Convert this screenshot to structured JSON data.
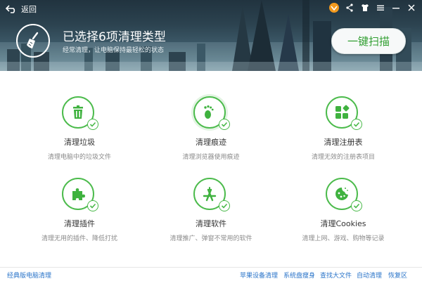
{
  "header": {
    "back_label": "返回",
    "title": "已选择6项清理类型",
    "subtitle": "经常清理，让电脑保持最轻松的状态",
    "scan_button": "一键扫描"
  },
  "items": [
    {
      "title": "清理垃圾",
      "desc": "清理电脑中的垃圾文件",
      "icon": "trash-icon",
      "checked": true
    },
    {
      "title": "清理痕迹",
      "desc": "清理浏览器使用痕迹",
      "icon": "footprint-icon",
      "checked": true
    },
    {
      "title": "清理注册表",
      "desc": "清理无效的注册表项目",
      "icon": "registry-icon",
      "checked": true
    },
    {
      "title": "清理插件",
      "desc": "清理无用的插件、降低打扰",
      "icon": "puzzle-icon",
      "checked": true
    },
    {
      "title": "清理软件",
      "desc": "清理推广、弹窗不常用的软件",
      "icon": "app-store-icon",
      "checked": true
    },
    {
      "title": "清理Cookies",
      "desc": "清理上网、游戏、购物等记录",
      "icon": "cookie-icon",
      "checked": true
    }
  ],
  "footer": {
    "classic": "经典版电脑清理",
    "links": [
      "苹果设备清理",
      "系统盘瘦身",
      "查找大文件",
      "自动清理",
      "恢复区"
    ]
  },
  "colors": {
    "accent": "#4cbb4c",
    "link": "#2a74c9"
  }
}
